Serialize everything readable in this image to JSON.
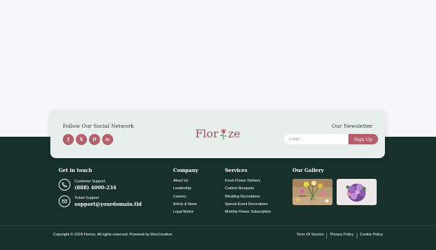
{
  "social": {
    "title": "Follow Our Social Network",
    "items": [
      {
        "name": "facebook",
        "glyph": "f"
      },
      {
        "name": "x",
        "glyph": "𝕏"
      },
      {
        "name": "pinterest",
        "glyph": "P"
      },
      {
        "name": "linkedin",
        "glyph": "in"
      }
    ]
  },
  "brand": {
    "logo_part1": "Flor",
    "logo_part2": "ze"
  },
  "newsletter": {
    "title": "Our Newsletter",
    "email_placeholder": "Email",
    "button_label": "Sign Up"
  },
  "contact": {
    "title": "Get in touch",
    "items": [
      {
        "icon": "phone-icon",
        "label": "Customer Support",
        "value": "(888) 4000-234"
      },
      {
        "icon": "mail-icon",
        "label": "Ticket Support",
        "value": "support@yourdomain.tld"
      }
    ]
  },
  "company": {
    "title": "Company",
    "links": [
      "About Us",
      "Leadership",
      "Careers",
      "Article & News",
      "Legal Notice"
    ]
  },
  "services": {
    "title": "Services",
    "links": [
      "Fresh Flower Delivery",
      "Custom Bouquets",
      "Wedding Decorations",
      "Special Event Decorations",
      "Monthly Flower Subscription"
    ]
  },
  "gallery": {
    "title": "Our Gallery"
  },
  "bottom": {
    "copyright": "Copyright © 2024 Florize, All rights reserved. Powered by MoxCreative.",
    "links": [
      "Term Of Service",
      "Privacy Policy",
      "Cookie Policy"
    ]
  },
  "colors": {
    "footer_bg": "#17302a",
    "accent": "#b45f6b",
    "card_bg": "#e6efec"
  }
}
